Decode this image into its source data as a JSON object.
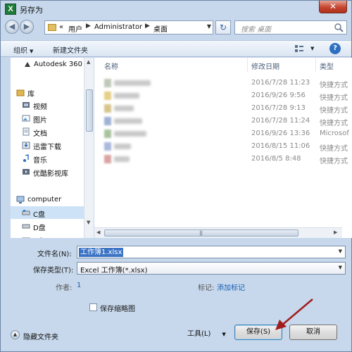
{
  "window": {
    "title": "另存为",
    "app_icon_letter": "X",
    "close_glyph": "✕"
  },
  "address": {
    "back_glyph": "◀",
    "forward_glyph": "▶",
    "prefix": "«",
    "crumbs": [
      "用户",
      "Administrator",
      "桌面"
    ],
    "separator": "▶",
    "dropdown_glyph": "▼",
    "refresh_glyph": "↻"
  },
  "search": {
    "placeholder": "搜索 桌面"
  },
  "toolbar": {
    "organize": "组织",
    "new_folder": "新建文件夹",
    "help": "?"
  },
  "nav": {
    "items": [
      {
        "label": "Autodesk 360",
        "icon": "cloud-icon"
      },
      {
        "label": "库",
        "icon": "library-icon"
      },
      {
        "label": "视频",
        "icon": "video-icon"
      },
      {
        "label": "图片",
        "icon": "picture-icon"
      },
      {
        "label": "文档",
        "icon": "document-icon"
      },
      {
        "label": "迅雷下载",
        "icon": "download-icon"
      },
      {
        "label": "音乐",
        "icon": "music-icon"
      },
      {
        "label": "优酷影视库",
        "icon": "video-library-icon"
      },
      {
        "label": "computer",
        "icon": "computer-icon"
      },
      {
        "label": "C盘",
        "icon": "drive-icon"
      },
      {
        "label": "D盘",
        "icon": "drive-icon"
      },
      {
        "label": "E盘",
        "icon": "drive-icon"
      }
    ]
  },
  "file_list": {
    "columns": {
      "name": "名称",
      "modified": "修改日期",
      "type": "类型"
    },
    "rows": [
      {
        "modified": "2016/7/28 11:23",
        "type": "快捷方式"
      },
      {
        "modified": "2016/9/26 9:56",
        "type": "快捷方式"
      },
      {
        "modified": "2016/7/28 9:13",
        "type": "快捷方式"
      },
      {
        "modified": "2016/7/28 11:24",
        "type": "快捷方式"
      },
      {
        "modified": "2016/9/26 13:36",
        "type": "Microsof"
      },
      {
        "modified": "2016/8/15 11:06",
        "type": "快捷方式"
      },
      {
        "modified": "2016/8/5 8:48",
        "type": "快捷方式"
      }
    ]
  },
  "form": {
    "filename_label": "文件名(N):",
    "filename_value": "工作簿1.xlsx",
    "filetype_label": "保存类型(T):",
    "filetype_value": "Excel 工作簿(*.xlsx)",
    "author_label": "作者:",
    "author_value": "1",
    "tags_label": "标记:",
    "tags_value": "添加标记",
    "thumbnail_label": "保存缩略图",
    "thumbnail_checked": false
  },
  "footer": {
    "hide_folders": "隐藏文件夹",
    "tools": "工具(L)",
    "save": "保存(S)",
    "cancel": "取消"
  },
  "colors": {
    "selection": "#3b73c5",
    "annotation_arrow": "#a11d1d",
    "link": "#1a5fb4"
  }
}
